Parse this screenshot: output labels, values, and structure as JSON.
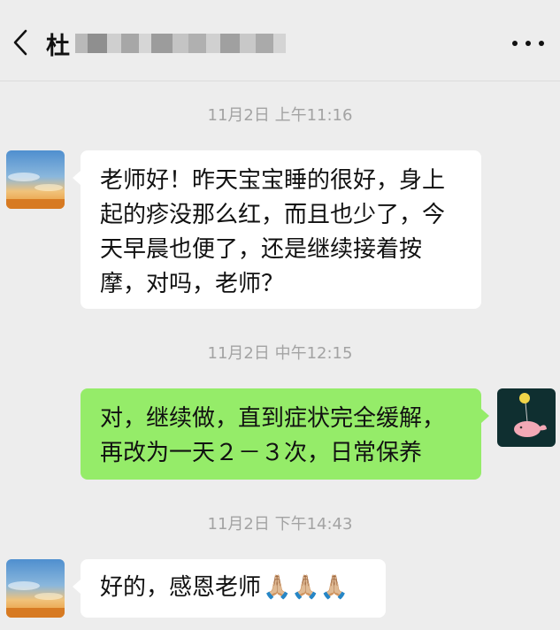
{
  "header": {
    "title_visible": "杜",
    "title_blurred": true,
    "back_icon": "chevron-left-icon",
    "more_icon": "more-dots-icon"
  },
  "messages": [
    {
      "timestamp": "11月2日 上午11:16",
      "side": "left",
      "lines": [
        "老师好！昨天宝宝睡的很好，身上",
        "起的疹没那么红，而且也少了，今",
        "天早晨也便了，还是继续接着按",
        "摩，对吗，老师？"
      ]
    },
    {
      "timestamp": "11月2日 中午12:15",
      "side": "right",
      "lines": [
        "对，继续做，直到症状完全缓解，",
        "再改为一天２－３次，日常保养"
      ]
    },
    {
      "timestamp": "11月2日 下午14:43",
      "side": "left",
      "text": "好的，感恩老师",
      "emoji": "🙏🏼🙏🏼🙏🏼",
      "emoji_icon": "praying-hands-icon"
    }
  ],
  "colors": {
    "background": "#ededed",
    "sent_bubble": "#95ec69",
    "received_bubble": "#ffffff",
    "timestamp_text": "#a3a3a3"
  }
}
